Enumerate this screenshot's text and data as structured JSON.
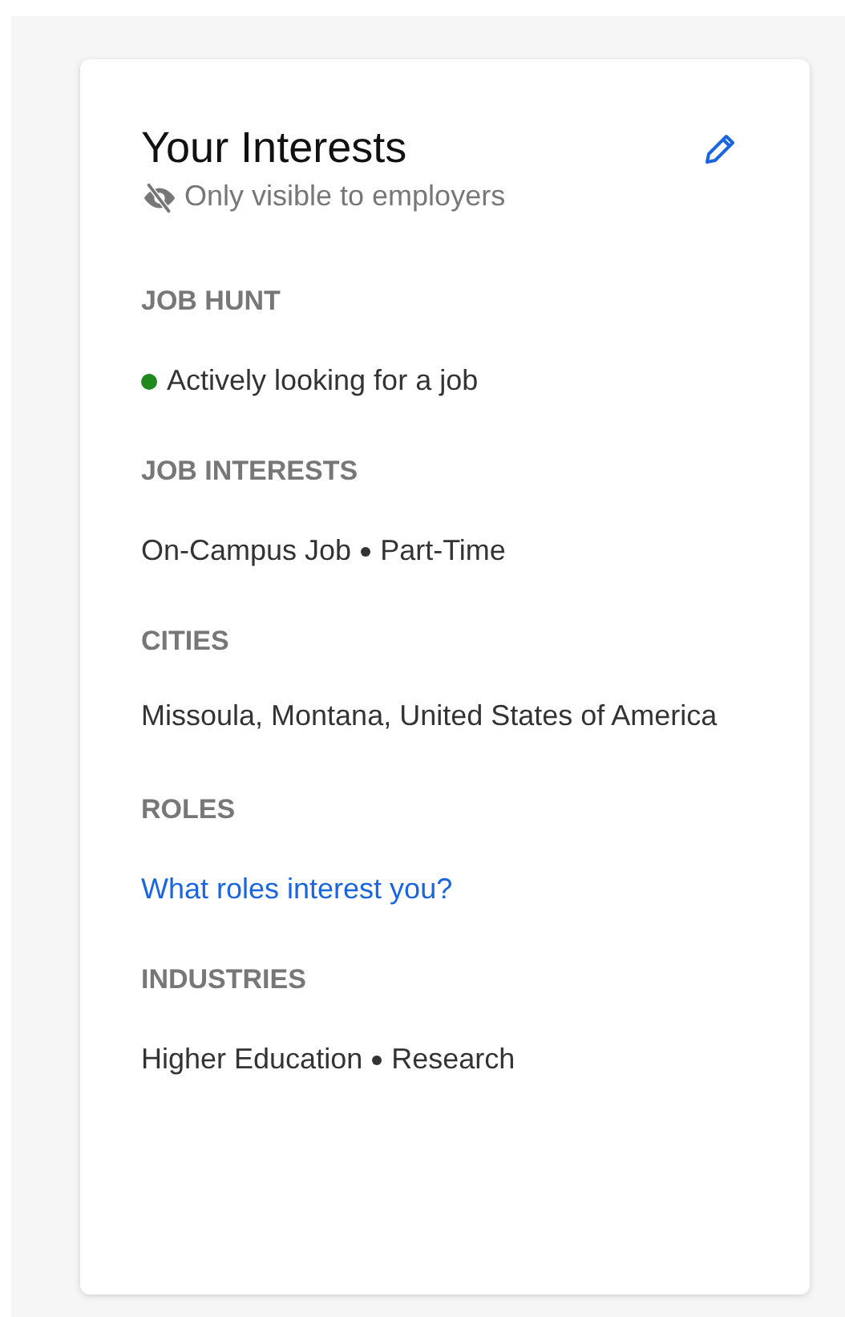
{
  "card": {
    "title": "Your Interests",
    "visibility_note": "Only visible to employers",
    "sections": [
      {
        "heading": "JOB HUNT",
        "kind": "status",
        "text": "Actively looking for a job",
        "color": "#1e8a1e"
      },
      {
        "heading": "JOB INTERESTS",
        "kind": "items",
        "items": [
          "On-Campus Job",
          "Part-Time"
        ]
      },
      {
        "heading": "CITIES",
        "kind": "text",
        "text": "Missoula, Montana, United States of America"
      },
      {
        "heading": "ROLES",
        "kind": "link",
        "text": "What roles interest you?"
      },
      {
        "heading": "INDUSTRIES",
        "kind": "items",
        "items": [
          "Higher Education",
          "Research"
        ]
      }
    ]
  }
}
